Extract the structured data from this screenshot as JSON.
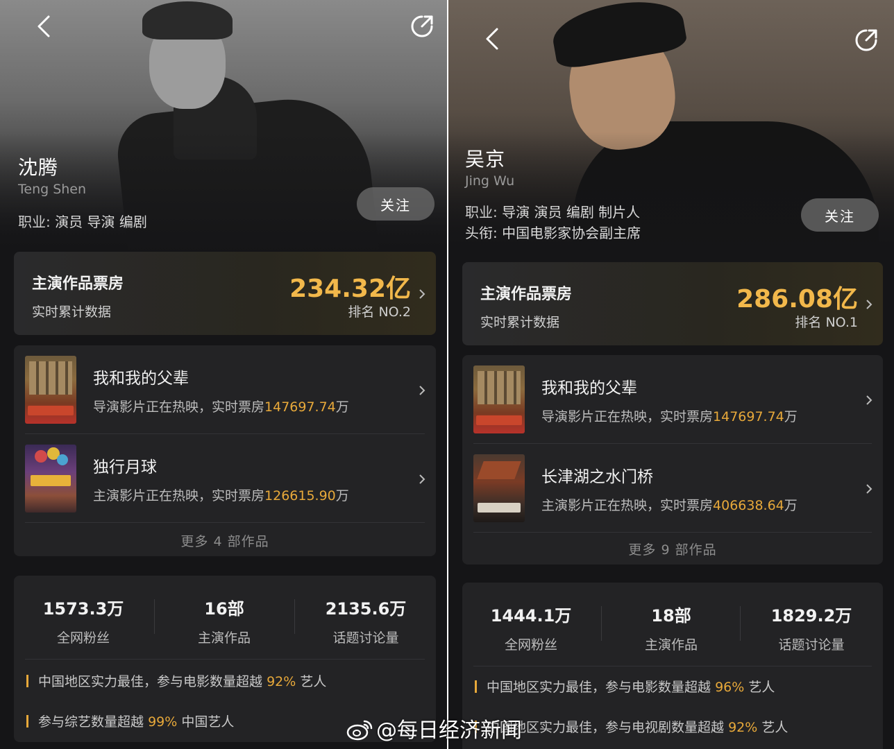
{
  "panels": [
    {
      "name_cn": "沈腾",
      "name_en": "Teng Shen",
      "occupation_label": "职业:",
      "occupation": "演员 导演 编剧",
      "title_line": "",
      "follow": "关注",
      "box_office": {
        "title": "主演作品票房",
        "subtitle": "实时累计数据",
        "value": "234.32亿",
        "rank": "排名 NO.2"
      },
      "works": [
        {
          "title": "我和我的父辈",
          "desc_prefix": "导演影片正在热映，实时票房",
          "value": "147697.74",
          "unit": "万"
        },
        {
          "title": "独行月球",
          "desc_prefix": "主演影片正在热映，实时票房",
          "value": "126615.90",
          "unit": "万"
        }
      ],
      "more_works": "更多 4 部作品",
      "stats": [
        {
          "value": "1573.3万",
          "label": "全网粉丝"
        },
        {
          "value": "16部",
          "label": "主演作品"
        },
        {
          "value": "2135.6万",
          "label": "话题讨论量"
        }
      ],
      "notes": [
        {
          "prefix": "中国地区实力最佳，参与电影数量超越",
          "hl": "92%",
          "suffix": "艺人"
        },
        {
          "prefix": "参与综艺数量超越",
          "hl": "99%",
          "suffix": "中国艺人"
        }
      ]
    },
    {
      "name_cn": "吴京",
      "name_en": "Jing Wu",
      "occupation_label": "职业:",
      "occupation": "导演 演员 编剧 制片人",
      "title_line": "头衔: 中国电影家协会副主席",
      "follow": "关注",
      "box_office": {
        "title": "主演作品票房",
        "subtitle": "实时累计数据",
        "value": "286.08亿",
        "rank": "排名 NO.1"
      },
      "works": [
        {
          "title": "我和我的父辈",
          "desc_prefix": "导演影片正在热映，实时票房",
          "value": "147697.74",
          "unit": "万"
        },
        {
          "title": "长津湖之水门桥",
          "desc_prefix": "主演影片正在热映，实时票房",
          "value": "406638.64",
          "unit": "万"
        }
      ],
      "more_works": "更多 9 部作品",
      "stats": [
        {
          "value": "1444.1万",
          "label": "全网粉丝"
        },
        {
          "value": "18部",
          "label": "主演作品"
        },
        {
          "value": "1829.2万",
          "label": "话题讨论量"
        }
      ],
      "notes": [
        {
          "prefix": "中国地区实力最佳，参与电影数量超越",
          "hl": "96%",
          "suffix": "艺人"
        },
        {
          "prefix": "中国地区实力最佳，参与电视剧数量超越",
          "hl": "92%",
          "suffix": "艺人"
        }
      ]
    }
  ],
  "watermark": "@每日经济新闻",
  "colors": {
    "highlight": "#e8a93a",
    "box_office_value": "#f2b84b",
    "card": "#232325",
    "background": "#151517"
  },
  "icons": {
    "back": "back-arrow-icon",
    "share": "share-icon",
    "chevron": "chevron-right-icon",
    "weibo": "weibo-logo-icon"
  }
}
